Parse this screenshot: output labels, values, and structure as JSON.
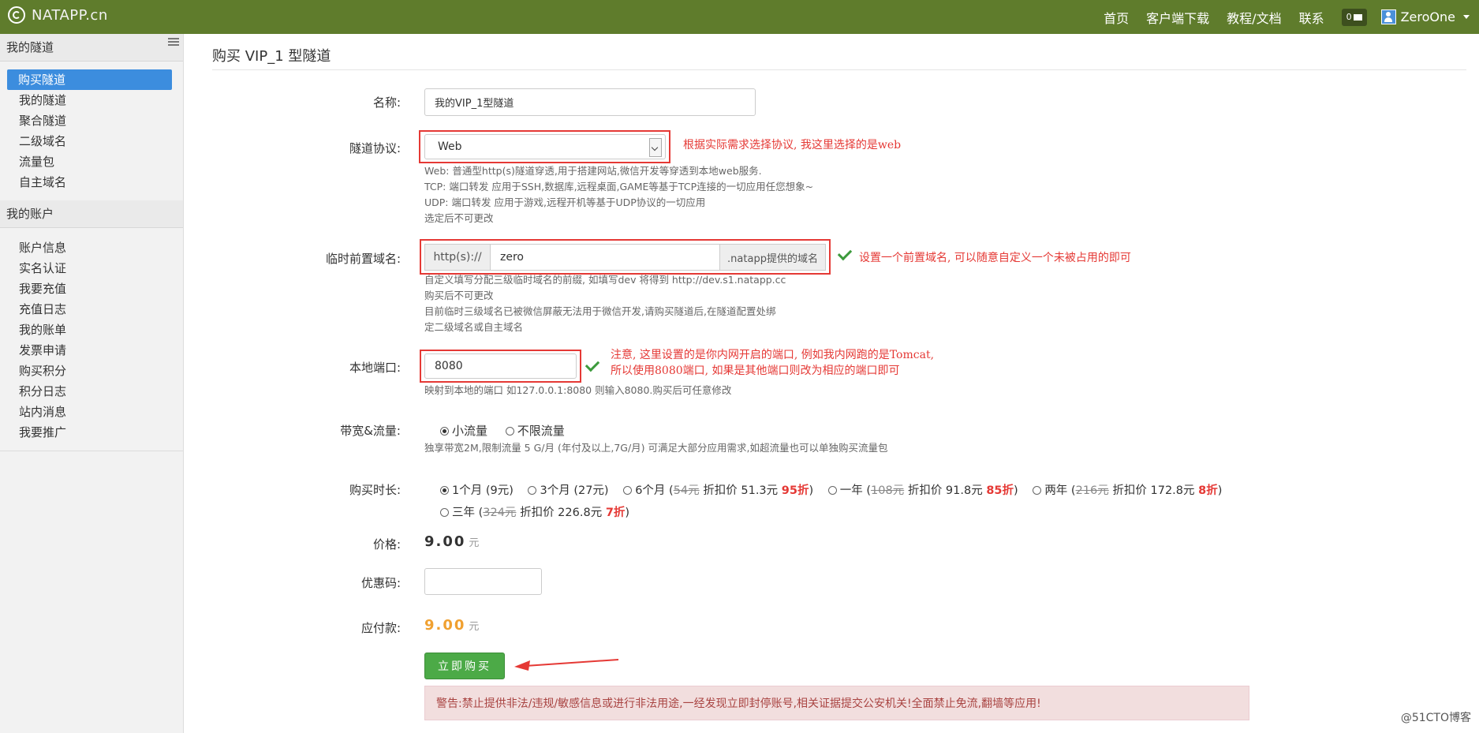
{
  "header": {
    "brand": "NATAPP.cn",
    "nav": [
      "首页",
      "客户端下载",
      "教程/文档",
      "联系"
    ],
    "msg_count": "0",
    "user": "ZeroOne"
  },
  "sidebar": {
    "group1_title": "我的隧道",
    "group1_items": [
      "购买隧道",
      "我的隧道",
      "聚合隧道",
      "二级域名",
      "流量包",
      "自主域名"
    ],
    "group2_title": "我的账户",
    "group2_items": [
      "账户信息",
      "实名认证",
      "我要充值",
      "充值日志",
      "我的账单",
      "发票申请",
      "购买积分",
      "积分日志",
      "站内消息",
      "我要推广"
    ]
  },
  "page": {
    "title": "购买 VIP_1 型隧道",
    "name": {
      "label": "名称:",
      "value": "我的VIP_1型隧道"
    },
    "protocol": {
      "label": "隧道协议:",
      "value": "Web",
      "help": [
        "Web: 普通型http(s)隧道穿透,用于搭建网站,微信开发等穿透到本地web服务.",
        "TCP: 端口转发 应用于SSH,数据库,远程桌面,GAME等基于TCP连接的一切应用任您想象~",
        "UDP: 端口转发 应用于游戏,远程开机等基于UDP协议的一切应用",
        "选定后不可更改"
      ],
      "annotation": "根据实际需求选择协议, 我这里选择的是web"
    },
    "subdomain": {
      "label": "临时前置域名:",
      "prefix": "http(s)://",
      "value": "zero",
      "suffix": ".natapp提供的域名",
      "help": [
        "自定义填写分配三级临时域名的前缀, 如填写dev 将得到 http://dev.s1.natapp.cc",
        "购买后不可更改",
        "目前临时三级域名已被微信屏蔽无法用于微信开发,请购买隧道后,在隧道配置处绑",
        "定二级域名或自主域名"
      ],
      "annotation": "设置一个前置域名, 可以随意自定义一个未被占用的即可"
    },
    "port": {
      "label": "本地端口:",
      "value": "8080",
      "help": "映射到本地的端口 如127.0.0.1:8080 则输入8080.购买后可任意修改",
      "annotation_line1": "注意, 这里设置的是你内网开启的端口, 例如我内网跑的是Tomcat,",
      "annotation_line2": "所以使用8080端口, 如果是其他端口则改为相应的端口即可"
    },
    "bandwidth": {
      "label": "带宽&流量:",
      "options": [
        "小流量",
        "不限流量"
      ],
      "selected": "小流量",
      "help": "独享带宽2M,限制流量 5 G/月 (年付及以上,7G/月) 可满足大部分应用需求,如超流量也可以单独购买流量包"
    },
    "duration": {
      "label": "购买时长:",
      "opt1": "1个月 (9元)",
      "opt2": "3个月 (27元)",
      "opt3_a": "6个月 (",
      "opt3_strike": "54元",
      "opt3_b": " 折扣价 51.3元 ",
      "opt3_disc": "95折",
      "opt3_c": ")",
      "opt4_a": "一年 (",
      "opt4_strike": "108元",
      "opt4_b": " 折扣价 91.8元 ",
      "opt4_disc": "85折",
      "opt4_c": ")",
      "opt5_a": "两年 (",
      "opt5_strike": "216元",
      "opt5_b": " 折扣价 172.8元 ",
      "opt5_disc": "8折",
      "opt5_c": ")",
      "opt6_a": "三年 (",
      "opt6_strike": "324元",
      "opt6_b": " 折扣价 226.8元 ",
      "opt6_disc": "7折",
      "opt6_c": ")",
      "selected": "1个月 (9元)"
    },
    "price": {
      "label": "价格:",
      "value": "9.00",
      "unit": "元"
    },
    "coupon": {
      "label": "优惠码:",
      "value": ""
    },
    "payable": {
      "label": "应付款:",
      "value": "9.00",
      "unit": "元"
    },
    "buy_button": "立即购买",
    "warning": "警告:禁止提供非法/违规/敏感信息或进行非法用途,一经发现立即封停账号,相关证据提交公安机关!全面禁止免流,翻墙等应用!"
  },
  "watermark": "@51CTO博客",
  "colors": {
    "topbar": "#5f7c2c",
    "active": "#3c8dde",
    "annotation": "#e53935",
    "buy": "#4caa47",
    "payable": "#f0a030"
  }
}
